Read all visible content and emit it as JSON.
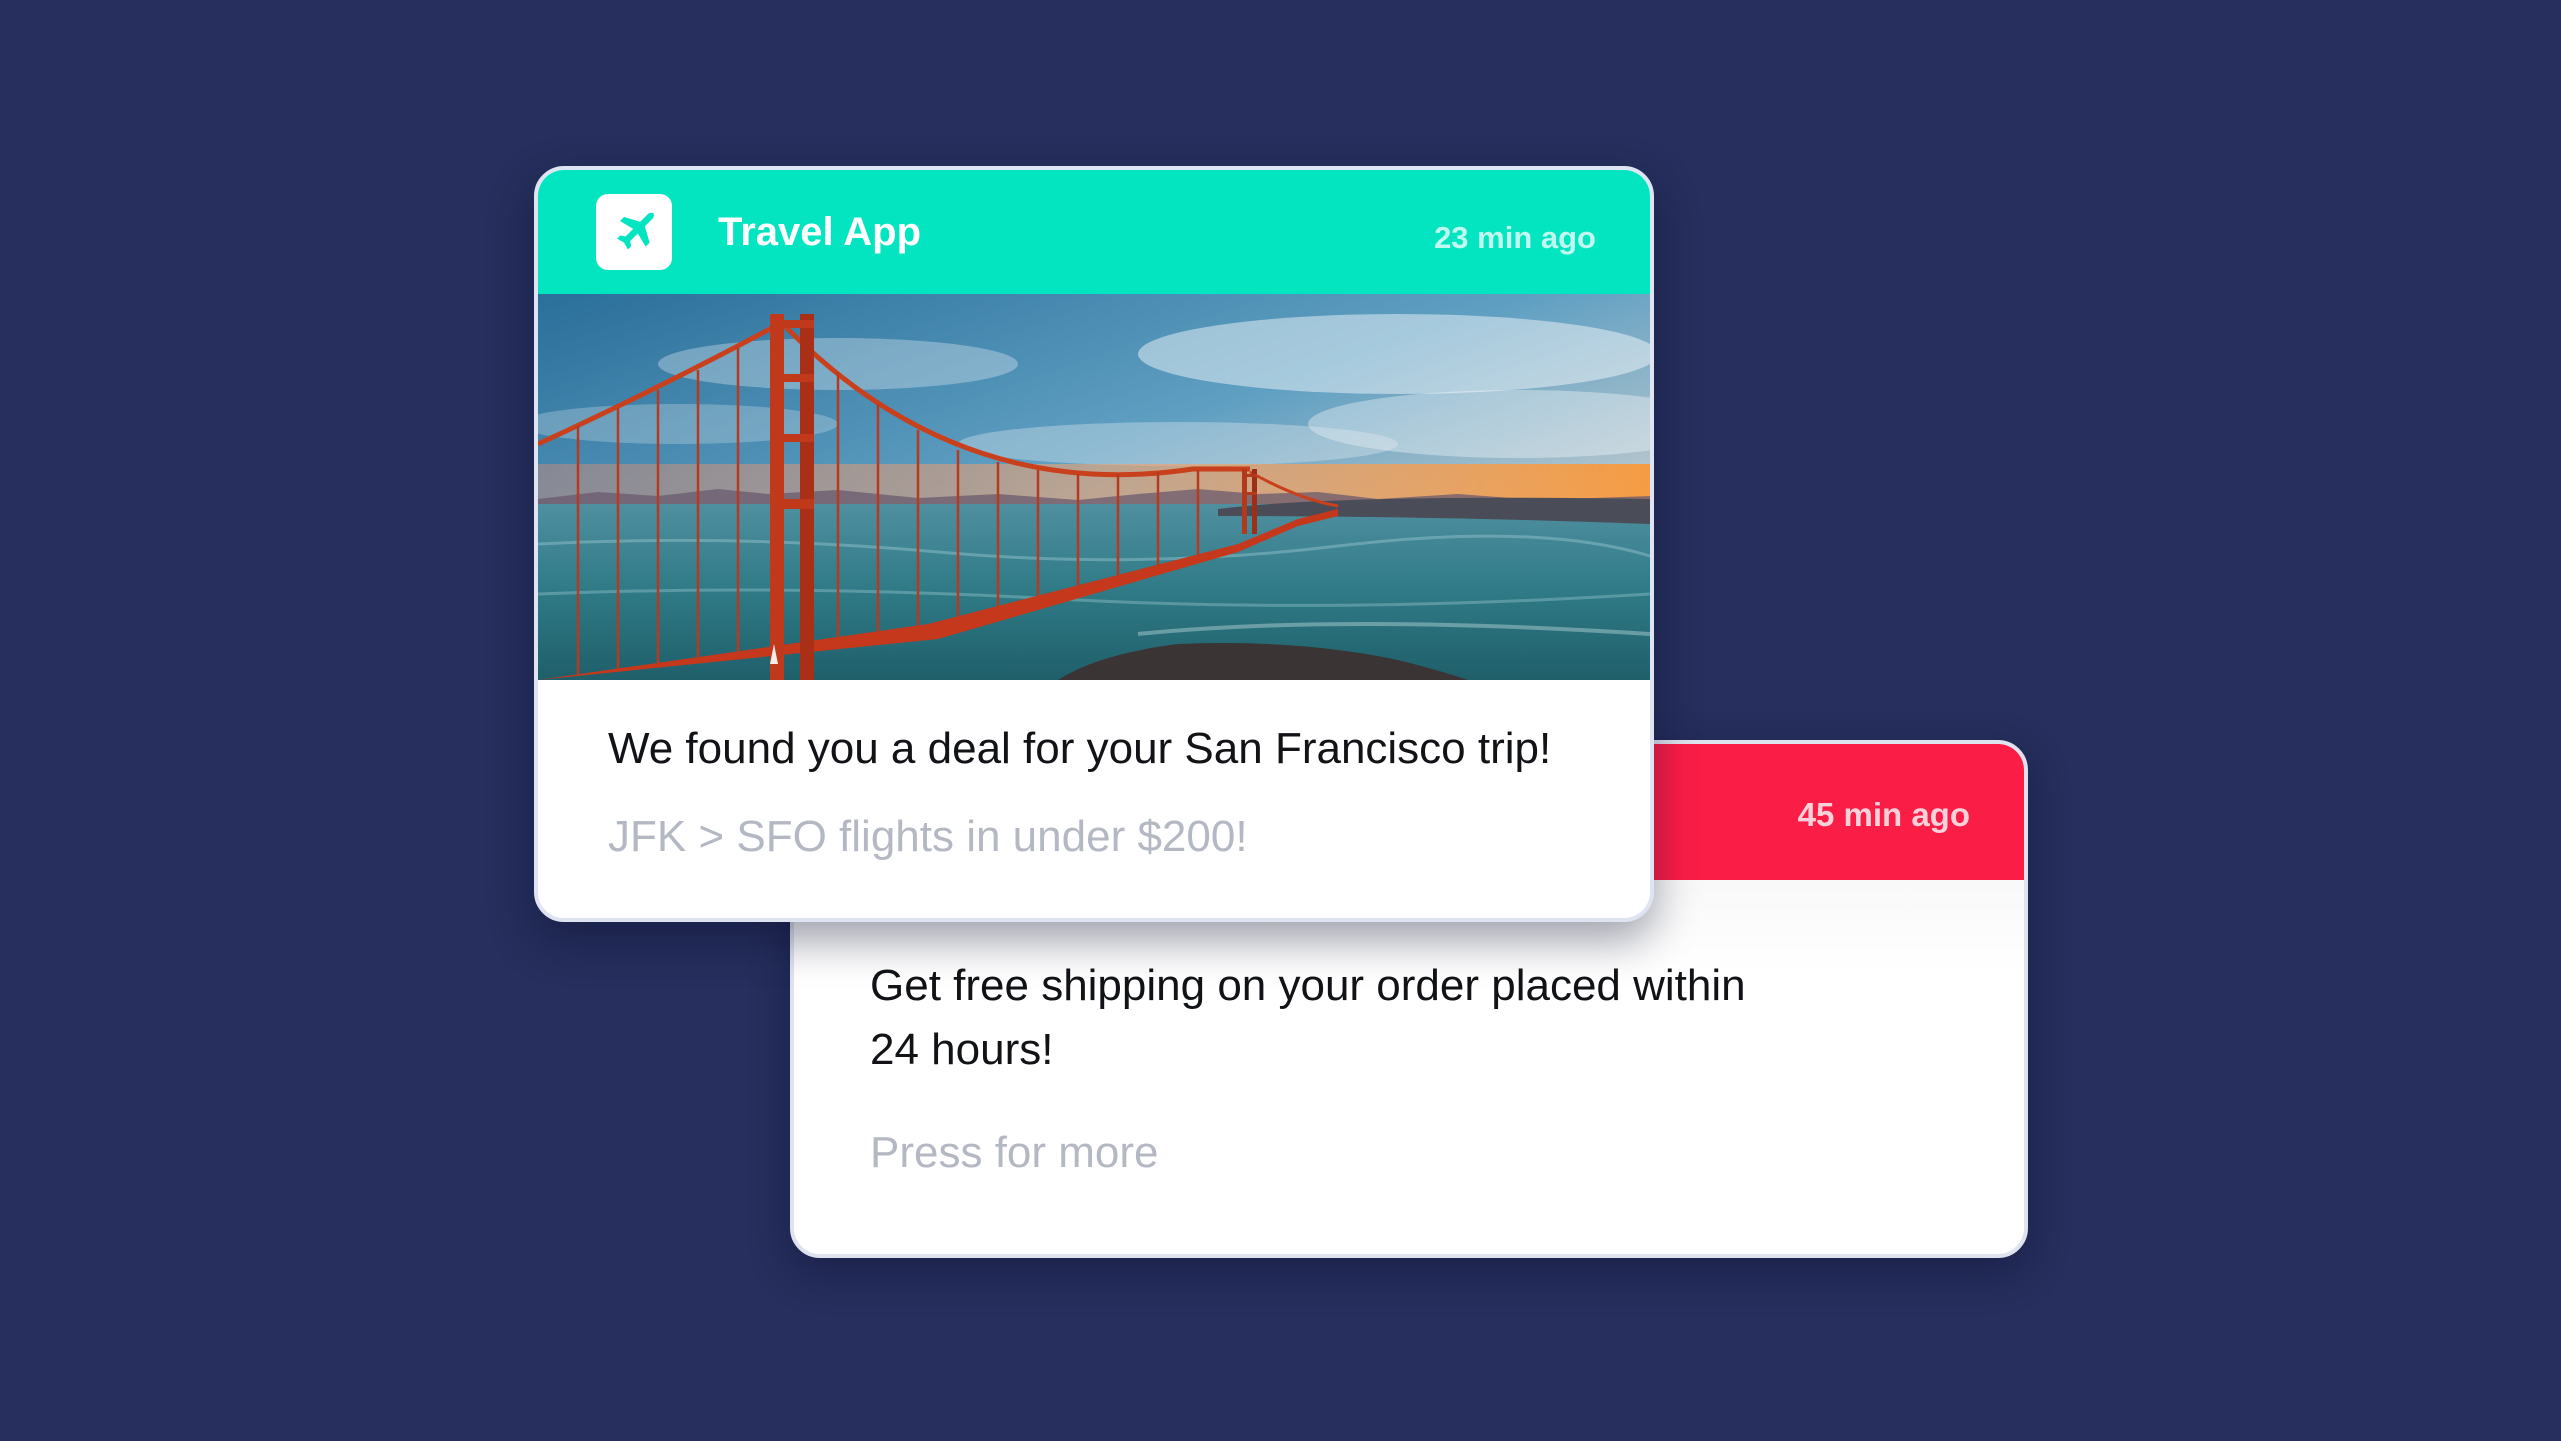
{
  "colors": {
    "background": "#262f5d",
    "travel_accent": "#02e5c0",
    "shop_accent": "#fa1d46"
  },
  "travel_notification": {
    "app_icon": "airplane-icon",
    "app_name": "Travel App",
    "time": "23 min ago",
    "image": "golden-gate-bridge-photo",
    "title": "We found you a deal for your San Francisco trip!",
    "subtitle": "JFK > SFO flights in under $200!"
  },
  "shipping_notification": {
    "time": "45 min ago",
    "message": "Get free shipping on your order placed within 24 hours!",
    "cta": "Press for more"
  }
}
